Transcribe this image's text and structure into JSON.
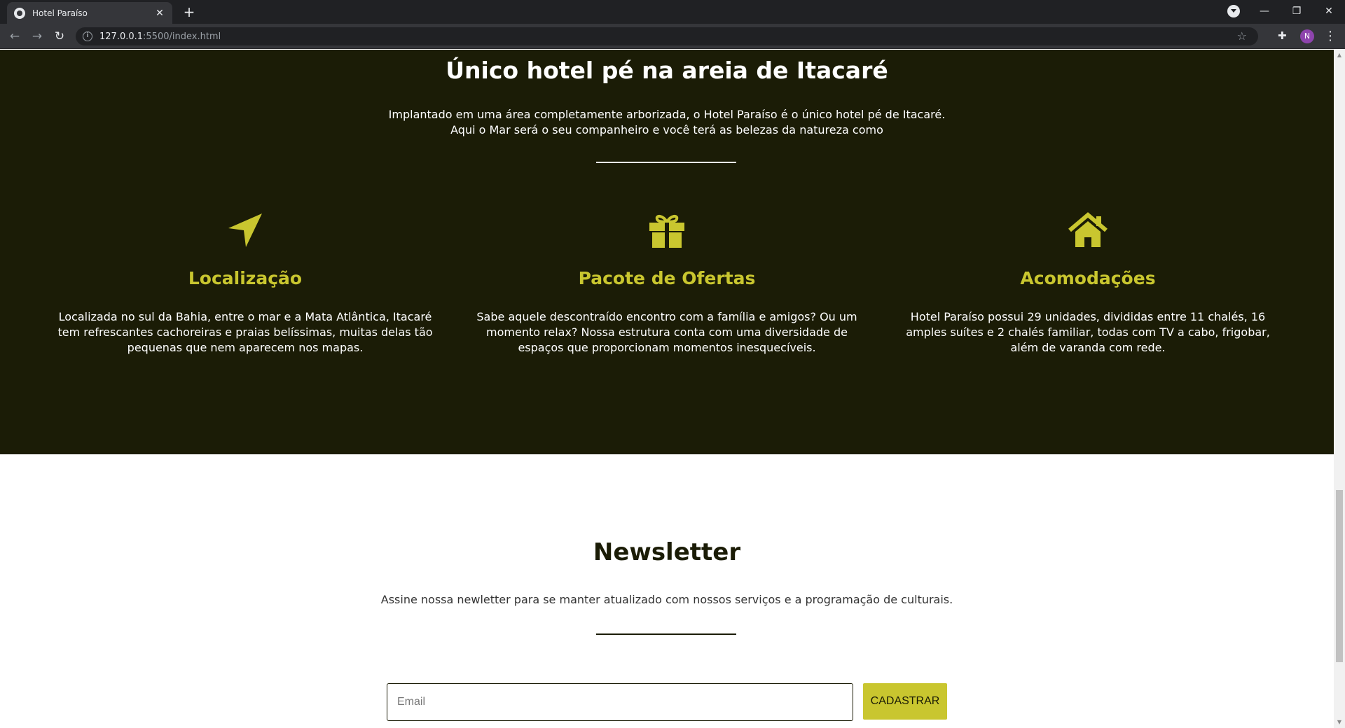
{
  "browser": {
    "tab_title": "Hotel Paraíso",
    "tab_close": "✕",
    "new_tab": "+",
    "url_host": "127.0.0.1",
    "url_path": ":5500/index.html",
    "avatar_letter": "N",
    "win_minimize": "—",
    "win_restore": "❐",
    "win_close": "✕"
  },
  "intro": {
    "title": "Único hotel pé na areia de Itacaré",
    "description": "Implantado em uma área completamente arborizada, o Hotel Paraíso é o único hotel pé de Itacaré. Aqui o Mar será o seu companheiro e você terá as belezas da natureza como"
  },
  "features": [
    {
      "icon": "location-arrow-icon",
      "title": "Localização",
      "text": "Localizada no sul da Bahia, entre o mar e a Mata Atlântica, Itacaré tem refrescantes cachoreiras e praias belíssimas, muitas delas tão pequenas que nem aparecem nos mapas."
    },
    {
      "icon": "gift-icon",
      "title": "Pacote de Ofertas",
      "text": "Sabe aquele descontraído encontro com a família e amigos? Ou um momento relax? Nossa estrutura conta com uma diversidade de espaços que proporcionam momentos inesquecíveis."
    },
    {
      "icon": "home-icon",
      "title": "Acomodações",
      "text": "Hotel Paraíso possui 29 unidades, divididas entre 11 chalés, 16 amples suítes e 2 chalés familiar, todas com TV a cabo, frigobar, além de varanda com rede."
    }
  ],
  "newsletter": {
    "title": "Newsletter",
    "description": "Assine nossa newletter para se manter atualizado com nossos serviços e a programação de culturais.",
    "email_placeholder": "Email",
    "submit_label": "CADASTRAR"
  },
  "colors": {
    "dark_bg": "#1b1c06",
    "accent": "#c9c62f",
    "chrome_dark": "#202124"
  }
}
